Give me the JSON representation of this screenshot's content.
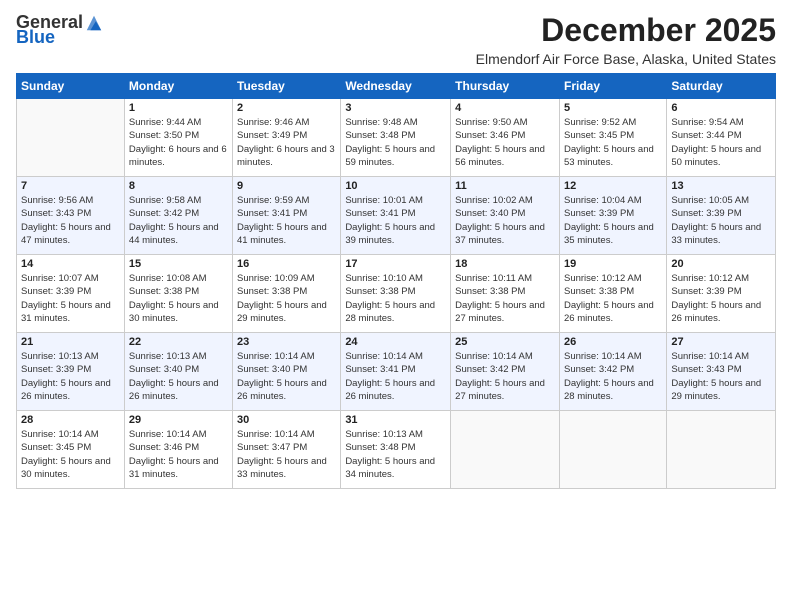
{
  "logo": {
    "general": "General",
    "blue": "Blue"
  },
  "header": {
    "month": "December 2025",
    "location": "Elmendorf Air Force Base, Alaska, United States"
  },
  "days": [
    "Sunday",
    "Monday",
    "Tuesday",
    "Wednesday",
    "Thursday",
    "Friday",
    "Saturday"
  ],
  "weeks": [
    [
      {
        "day": "",
        "sunrise": "",
        "sunset": "",
        "daylight": ""
      },
      {
        "day": "1",
        "sunrise": "9:44 AM",
        "sunset": "3:50 PM",
        "daylight": "6 hours and 6 minutes."
      },
      {
        "day": "2",
        "sunrise": "9:46 AM",
        "sunset": "3:49 PM",
        "daylight": "6 hours and 3 minutes."
      },
      {
        "day": "3",
        "sunrise": "9:48 AM",
        "sunset": "3:48 PM",
        "daylight": "5 hours and 59 minutes."
      },
      {
        "day": "4",
        "sunrise": "9:50 AM",
        "sunset": "3:46 PM",
        "daylight": "5 hours and 56 minutes."
      },
      {
        "day": "5",
        "sunrise": "9:52 AM",
        "sunset": "3:45 PM",
        "daylight": "5 hours and 53 minutes."
      },
      {
        "day": "6",
        "sunrise": "9:54 AM",
        "sunset": "3:44 PM",
        "daylight": "5 hours and 50 minutes."
      }
    ],
    [
      {
        "day": "7",
        "sunrise": "9:56 AM",
        "sunset": "3:43 PM",
        "daylight": "5 hours and 47 minutes."
      },
      {
        "day": "8",
        "sunrise": "9:58 AM",
        "sunset": "3:42 PM",
        "daylight": "5 hours and 44 minutes."
      },
      {
        "day": "9",
        "sunrise": "9:59 AM",
        "sunset": "3:41 PM",
        "daylight": "5 hours and 41 minutes."
      },
      {
        "day": "10",
        "sunrise": "10:01 AM",
        "sunset": "3:41 PM",
        "daylight": "5 hours and 39 minutes."
      },
      {
        "day": "11",
        "sunrise": "10:02 AM",
        "sunset": "3:40 PM",
        "daylight": "5 hours and 37 minutes."
      },
      {
        "day": "12",
        "sunrise": "10:04 AM",
        "sunset": "3:39 PM",
        "daylight": "5 hours and 35 minutes."
      },
      {
        "day": "13",
        "sunrise": "10:05 AM",
        "sunset": "3:39 PM",
        "daylight": "5 hours and 33 minutes."
      }
    ],
    [
      {
        "day": "14",
        "sunrise": "10:07 AM",
        "sunset": "3:39 PM",
        "daylight": "5 hours and 31 minutes."
      },
      {
        "day": "15",
        "sunrise": "10:08 AM",
        "sunset": "3:38 PM",
        "daylight": "5 hours and 30 minutes."
      },
      {
        "day": "16",
        "sunrise": "10:09 AM",
        "sunset": "3:38 PM",
        "daylight": "5 hours and 29 minutes."
      },
      {
        "day": "17",
        "sunrise": "10:10 AM",
        "sunset": "3:38 PM",
        "daylight": "5 hours and 28 minutes."
      },
      {
        "day": "18",
        "sunrise": "10:11 AM",
        "sunset": "3:38 PM",
        "daylight": "5 hours and 27 minutes."
      },
      {
        "day": "19",
        "sunrise": "10:12 AM",
        "sunset": "3:38 PM",
        "daylight": "5 hours and 26 minutes."
      },
      {
        "day": "20",
        "sunrise": "10:12 AM",
        "sunset": "3:39 PM",
        "daylight": "5 hours and 26 minutes."
      }
    ],
    [
      {
        "day": "21",
        "sunrise": "10:13 AM",
        "sunset": "3:39 PM",
        "daylight": "5 hours and 26 minutes."
      },
      {
        "day": "22",
        "sunrise": "10:13 AM",
        "sunset": "3:40 PM",
        "daylight": "5 hours and 26 minutes."
      },
      {
        "day": "23",
        "sunrise": "10:14 AM",
        "sunset": "3:40 PM",
        "daylight": "5 hours and 26 minutes."
      },
      {
        "day": "24",
        "sunrise": "10:14 AM",
        "sunset": "3:41 PM",
        "daylight": "5 hours and 26 minutes."
      },
      {
        "day": "25",
        "sunrise": "10:14 AM",
        "sunset": "3:42 PM",
        "daylight": "5 hours and 27 minutes."
      },
      {
        "day": "26",
        "sunrise": "10:14 AM",
        "sunset": "3:42 PM",
        "daylight": "5 hours and 28 minutes."
      },
      {
        "day": "27",
        "sunrise": "10:14 AM",
        "sunset": "3:43 PM",
        "daylight": "5 hours and 29 minutes."
      }
    ],
    [
      {
        "day": "28",
        "sunrise": "10:14 AM",
        "sunset": "3:45 PM",
        "daylight": "5 hours and 30 minutes."
      },
      {
        "day": "29",
        "sunrise": "10:14 AM",
        "sunset": "3:46 PM",
        "daylight": "5 hours and 31 minutes."
      },
      {
        "day": "30",
        "sunrise": "10:14 AM",
        "sunset": "3:47 PM",
        "daylight": "5 hours and 33 minutes."
      },
      {
        "day": "31",
        "sunrise": "10:13 AM",
        "sunset": "3:48 PM",
        "daylight": "5 hours and 34 minutes."
      },
      {
        "day": "",
        "sunrise": "",
        "sunset": "",
        "daylight": ""
      },
      {
        "day": "",
        "sunrise": "",
        "sunset": "",
        "daylight": ""
      },
      {
        "day": "",
        "sunrise": "",
        "sunset": "",
        "daylight": ""
      }
    ]
  ],
  "labels": {
    "sunrise": "Sunrise:",
    "sunset": "Sunset:",
    "daylight": "Daylight:"
  }
}
